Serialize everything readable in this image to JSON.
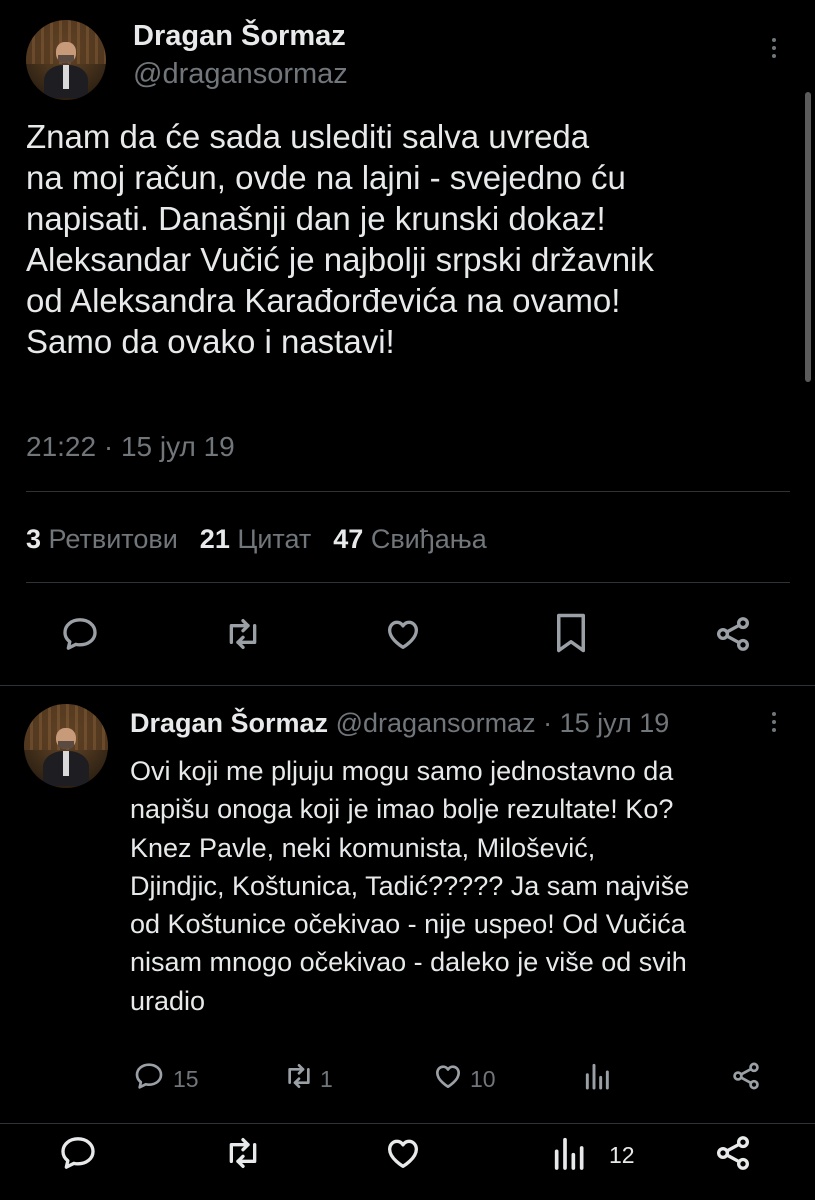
{
  "main_tweet": {
    "author_name": "Dragan Šormaz",
    "author_handle": "@dragansormaz",
    "text_lines": [
      "Znam da će sada uslediti salva uvreda",
      "na moj račun, ovde na lajni - svejedno ću",
      "napisati. Današnji dan je krunski dokaz!",
      "Aleksandar Vučić  je najbolji srpski državnik",
      "od Aleksandra Karađorđevića na ovamo!",
      "Samo da ovako i nastavi!"
    ],
    "timestamp": "21:22 · 15 јул 19",
    "stats": {
      "retweets_count": "3",
      "retweets_label": "Ретвитови",
      "quotes_count": "21",
      "quotes_label": "Цитат",
      "likes_count": "47",
      "likes_label": "Свиђања"
    },
    "actions": [
      "reply-icon",
      "retweet-icon",
      "like-icon",
      "bookmark-icon",
      "share-icon"
    ]
  },
  "reply_tweet": {
    "author_name": "Dragan Šormaz",
    "author_handle": "@dragansormaz",
    "date": "· 15 јул 19",
    "text_lines": [
      "Ovi koji me pljuju mogu samo jednostavno da",
      "napišu onoga koji je imao bolje rezultate! Ko?",
      "Knez Pavle, neki komunista, Milošević,",
      "Djindjic,  Koštunica,  Tadić????? Ja sam najviše",
      "od Koštunice očekivao  - nije uspeo! Od Vučića",
      "nisam mnogo očekivao - daleko je više od svih",
      "uradio"
    ],
    "reply_count": "15",
    "retweet_count": "1",
    "like_count": "10",
    "actions": [
      "reply-icon",
      "retweet-icon",
      "like-icon",
      "views-icon",
      "share-icon"
    ]
  },
  "bottom_bar": {
    "views_count": "12",
    "actions": [
      "reply-icon",
      "retweet-icon",
      "like-icon",
      "views-icon",
      "share-icon"
    ]
  },
  "colors": {
    "background": "#000000",
    "text": "#e7e9ea",
    "muted": "#71767b",
    "divider": "#2f3336"
  }
}
